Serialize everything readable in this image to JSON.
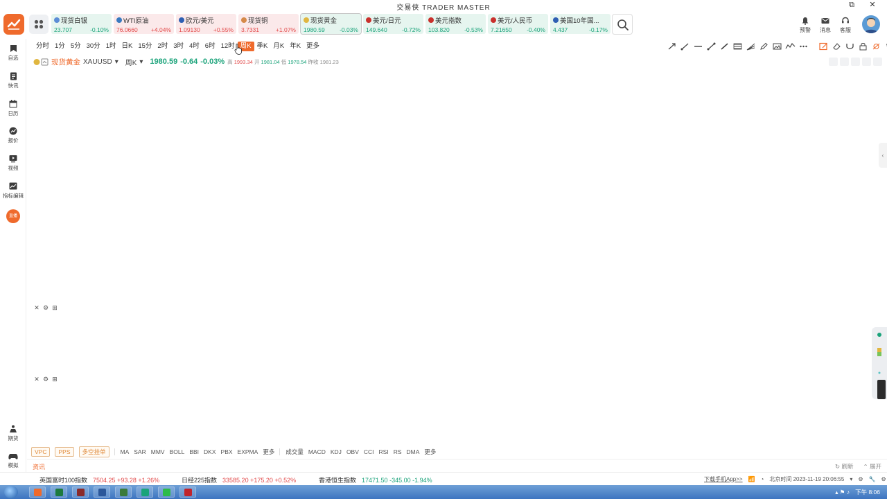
{
  "app": {
    "title": "交易侠 TRADER MASTER"
  },
  "window_controls": {
    "restore": "⧉",
    "close": "✕"
  },
  "quotes": [
    {
      "name": "现货白银",
      "price": "23.707",
      "change": "-0.10%",
      "dir": "down",
      "color": "#5b8dd6"
    },
    {
      "name": "WTI原油",
      "price": "76.0660",
      "change": "+4.04%",
      "dir": "up",
      "color": "#3a7ac0"
    },
    {
      "name": "欧元/美元",
      "price": "1.09130",
      "change": "+0.55%",
      "dir": "up",
      "color": "#2f5fb3"
    },
    {
      "name": "现货铜",
      "price": "3.7331",
      "change": "+1.07%",
      "dir": "up",
      "color": "#d58a4a"
    },
    {
      "name": "现货黄金",
      "price": "1980.59",
      "change": "-0.03%",
      "dir": "down",
      "color": "#e0b640",
      "active": true
    },
    {
      "name": "美元/日元",
      "price": "149.640",
      "change": "-0.72%",
      "dir": "down",
      "color": "#c9302c"
    },
    {
      "name": "美元指数",
      "price": "103.820",
      "change": "-0.53%",
      "dir": "down",
      "color": "#c9302c"
    },
    {
      "name": "美元/人民币",
      "price": "7.21650",
      "change": "-0.40%",
      "dir": "down",
      "color": "#c9302c"
    },
    {
      "name": "美国10年国...",
      "price": "4.437",
      "change": "-0.17%",
      "dir": "down",
      "color": "#2f5fb3"
    }
  ],
  "header_tools": {
    "alert": "预警",
    "message": "消息",
    "service": "客服"
  },
  "sidebar": {
    "items": [
      {
        "label": "自选",
        "icon": "bookmark-icon"
      },
      {
        "label": "快讯",
        "icon": "news-icon"
      },
      {
        "label": "日历",
        "icon": "calendar-icon"
      },
      {
        "label": "报价",
        "icon": "quote-icon"
      },
      {
        "label": "视频",
        "icon": "video-icon"
      },
      {
        "label": "指标编辑",
        "icon": "indicator-edit-icon"
      }
    ],
    "badge": "直播",
    "bottom": [
      {
        "label": "期货",
        "icon": "futures-icon"
      },
      {
        "label": "模拟",
        "icon": "gamepad-icon"
      }
    ]
  },
  "periods": [
    "分时",
    "1分",
    "5分",
    "30分",
    "1时",
    "日K",
    "15分",
    "2时",
    "3时",
    "4时",
    "6时",
    "12时",
    "周K",
    "季K",
    "月K",
    "年K",
    "更多"
  ],
  "active_period": "周K",
  "symbol": {
    "name": "现货黄金",
    "code": "XAUUSD",
    "period": "周K",
    "price": "1980.59",
    "change": "-0.64",
    "change_pct": "-0.03%",
    "high_label": "高",
    "high": "1993.34",
    "open_label": "开",
    "open": "1981.04",
    "low_label": "低",
    "low": "1978.54",
    "prev_label": "昨收",
    "prev": "1981.23"
  },
  "indicator_boxes": [
    "VPC",
    "PPS",
    "多空挂单"
  ],
  "indicators_main": [
    "MA",
    "SAR",
    "MMV",
    "BOLL",
    "BBI",
    "DKX",
    "PBX",
    "EXPMA",
    "更多"
  ],
  "indicators_sub": [
    "成交量",
    "MACD",
    "KDJ",
    "OBV",
    "CCI",
    "RSI",
    "RS",
    "DMA",
    "更多"
  ],
  "news": {
    "tab": "资讯",
    "refresh": "刷新",
    "expand": "展开"
  },
  "ticker": [
    {
      "name": "英国富时100指数",
      "price": "7504.25",
      "change": "+93.28",
      "pct": "+1.26%",
      "dir": "up"
    },
    {
      "name": "日经225指数",
      "price": "33585.20",
      "change": "+175.20",
      "pct": "+0.52%",
      "dir": "up"
    },
    {
      "name": "香港恒生指数",
      "price": "17471.50",
      "change": "-345.00",
      "pct": "-1.94%",
      "dir": "down"
    }
  ],
  "status": {
    "download": "下载手机App>>",
    "time": "北京时间 2023-11-19 20:06:55"
  },
  "taskbar": {
    "clock": "下午 8:06"
  }
}
